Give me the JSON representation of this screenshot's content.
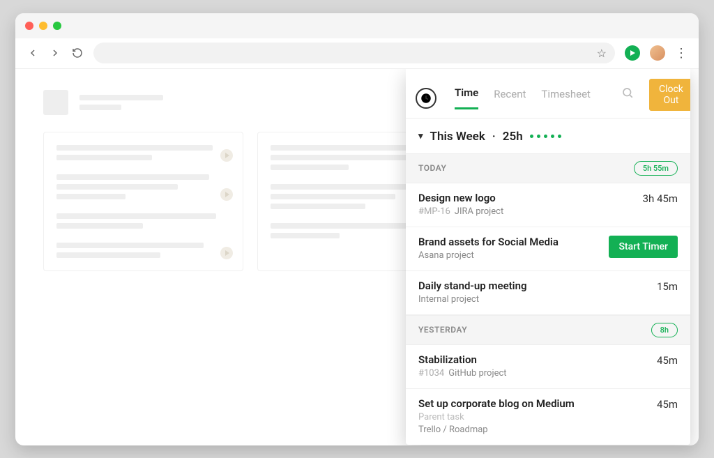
{
  "tabs": {
    "time": "Time",
    "recent": "Recent",
    "timesheet": "Timesheet"
  },
  "clock_out": "Clock Out",
  "week": {
    "label": "This Week",
    "separator": "·",
    "total": "25h"
  },
  "sections": [
    {
      "label": "TODAY",
      "total": "5h 55m",
      "entries": [
        {
          "title": "Design new logo",
          "tag": "#MP-16",
          "project": "JIRA project",
          "duration": "3h 45m",
          "action": null
        },
        {
          "title": "Brand assets for Social Media",
          "tag": null,
          "project": "Asana project",
          "duration": null,
          "action": "Start Timer"
        },
        {
          "title": "Daily stand-up meeting",
          "tag": null,
          "project": "Internal project",
          "duration": "15m",
          "action": null
        }
      ]
    },
    {
      "label": "YESTERDAY",
      "total": "8h",
      "entries": [
        {
          "title": "Stabilization",
          "tag": "#1034",
          "project": "GitHub project",
          "duration": "45m",
          "action": null
        },
        {
          "title": "Set up corporate blog on Medium",
          "tag": null,
          "parent": "Parent task",
          "project": "Trello / Roadmap",
          "duration": "45m",
          "action": null
        }
      ]
    }
  ]
}
